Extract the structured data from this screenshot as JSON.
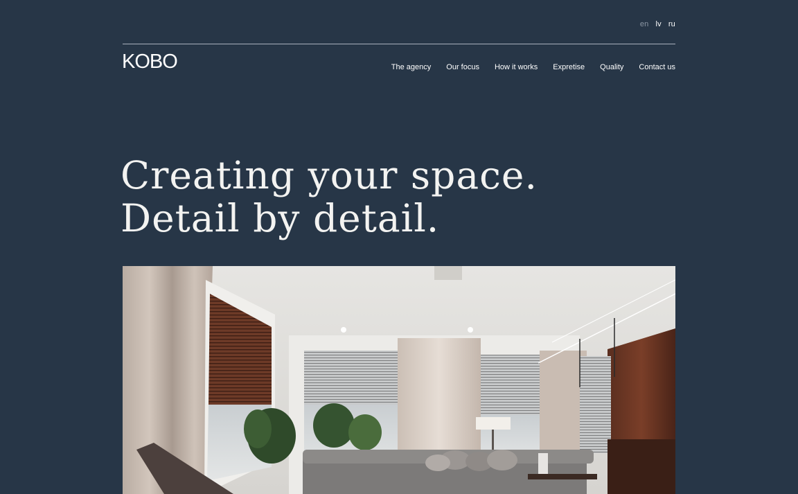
{
  "languages": [
    {
      "code": "en",
      "active": true
    },
    {
      "code": "lv",
      "active": false
    },
    {
      "code": "ru",
      "active": false
    }
  ],
  "logo": "KOBO",
  "nav": [
    "The agency",
    "Our focus",
    "How it works",
    "Expretise",
    "Quality",
    "Contact us"
  ],
  "hero": {
    "line1": "Creating your space.",
    "line2": "Detail by detail."
  },
  "colors": {
    "background": "#273647",
    "text": "#ffffff",
    "muted": "#8c97a4"
  },
  "image": {
    "subject": "modern-living-room-interior"
  }
}
